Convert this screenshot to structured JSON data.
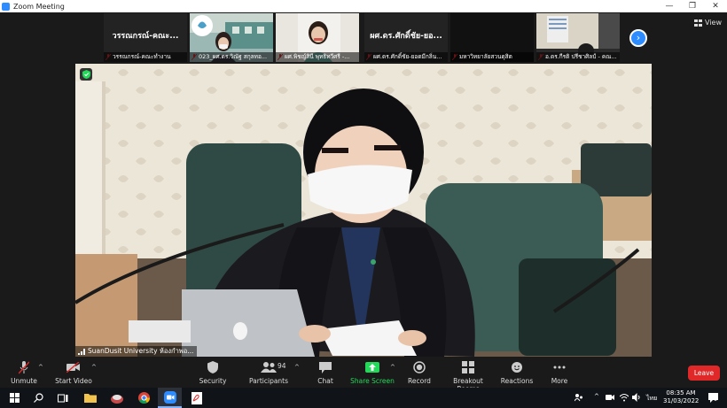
{
  "window": {
    "title": "Zoom Meeting",
    "controls": {
      "minimize": "—",
      "restore": "❐",
      "close": "✕"
    }
  },
  "gallery": {
    "view_label": "View",
    "tiles": [
      {
        "big_name": "วรรณกรณ์-คณะ...",
        "label": "วรรณกรณ์-คณะทำงาน"
      },
      {
        "big_name": "",
        "label": "023_ผศ.ดร.วิณัฐ สกุลทอ..."
      },
      {
        "big_name": "",
        "label": "ผศ.พิชญ์สินี พุทธิทวีศรี -..."
      },
      {
        "big_name": "ผศ.ดร.ศักดิ์ชัย-ยอ...",
        "label": "ผศ.ดร.ศักดิ์ชัย-ยอดมีกลิ่น..."
      },
      {
        "big_name": "",
        "label": "มหาวิทยาลัยสวนดุสิต"
      },
      {
        "big_name": "",
        "label": "อ.ดร.กีรติ ปรีชาศิลป์ - คณ..."
      }
    ]
  },
  "main_video": {
    "speaker_name": "SuanDusit University ห้องกำพอ..."
  },
  "toolbar": {
    "unmute": "Unmute",
    "start_video": "Start Video",
    "security": "Security",
    "participants": "Participants",
    "participants_count": "94",
    "chat": "Chat",
    "share_screen": "Share Screen",
    "record": "Record",
    "breakout_rooms": "Breakout Rooms",
    "reactions": "Reactions",
    "more": "More",
    "leave": "Leave",
    "colors": {
      "accent": "#2d8cff",
      "leave": "#e02828",
      "share": "#23d959"
    }
  },
  "taskbar": {
    "language": "ไทย",
    "time": "08:35 AM",
    "date": "31/03/2022",
    "notification_count": "1"
  }
}
